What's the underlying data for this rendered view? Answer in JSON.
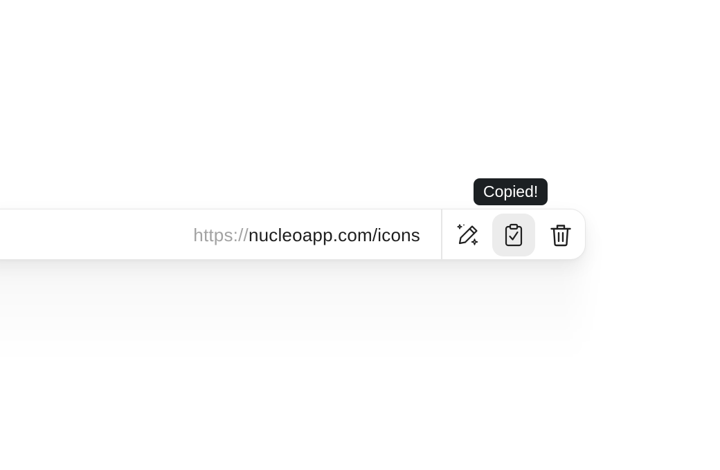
{
  "url_bar": {
    "scheme": "https://",
    "host_path": "nucleoapp.com/icons"
  },
  "actions": [
    {
      "name": "edit",
      "icon": "pencil-sparkle-icon"
    },
    {
      "name": "copy",
      "icon": "clipboard-check-icon",
      "active": true
    },
    {
      "name": "delete",
      "icon": "trash-icon"
    }
  ],
  "tooltip": {
    "text": "Copied!"
  },
  "colors": {
    "scheme_text": "#a3a3a3",
    "url_text": "#1f1f1f",
    "tooltip_bg": "#1c2023",
    "active_button_bg": "#ececec",
    "border": "#e6e6e6"
  }
}
